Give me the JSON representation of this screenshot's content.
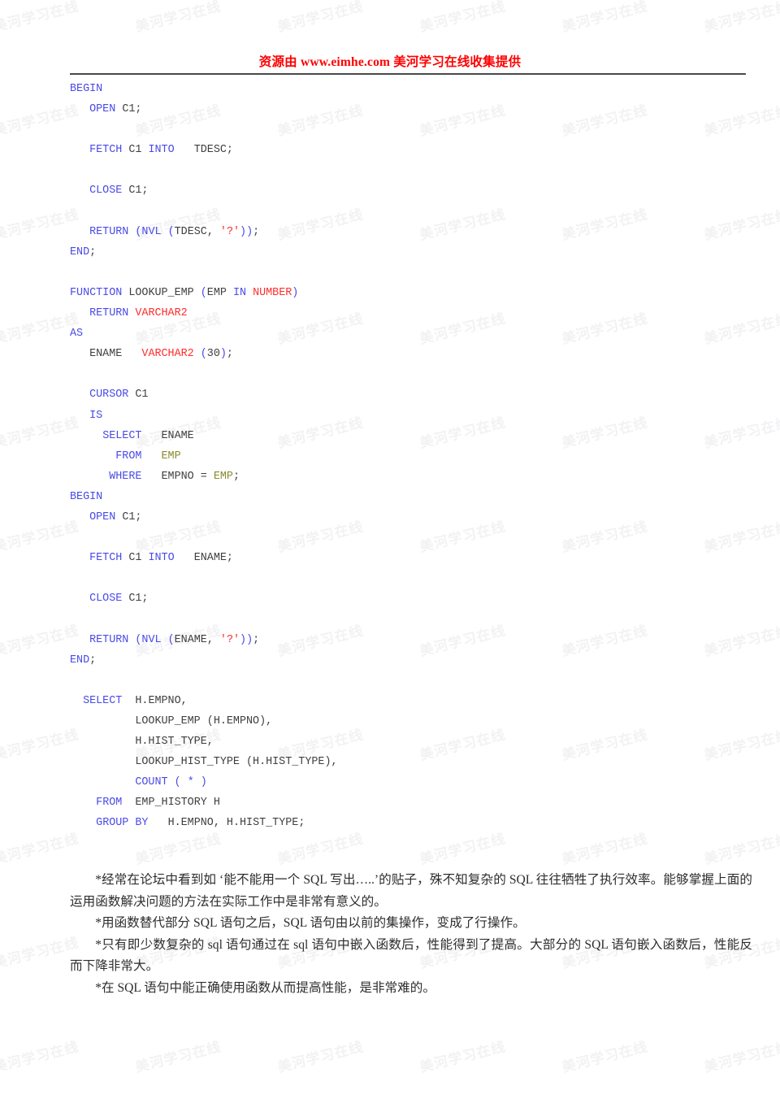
{
  "document": {
    "header": {
      "watermark_notice": "资源由 www.eimhe.com 美河学习在线收集提供",
      "rule_color": "#4a4a4a"
    },
    "background_watermark_text": "美河学习在线",
    "colors": {
      "keyword": "#4a4ae8",
      "datatype": "#ff2d2d",
      "variable": "#8a8a2e",
      "identifier": "#3f3f3f",
      "header_red": "#ff0000",
      "page_background": "#ffffff"
    },
    "code": {
      "language": "PL/SQL",
      "lines": [
        "BEGIN",
        "   OPEN C1;",
        "",
        "   FETCH C1 INTO   TDESC;",
        "",
        "   CLOSE C1;",
        "",
        "   RETURN (NVL (TDESC, '?'));",
        "END;",
        "",
        "FUNCTION LOOKUP_EMP (EMP IN NUMBER)",
        "   RETURN VARCHAR2",
        "AS",
        "   ENAME   VARCHAR2 (30);",
        "",
        "   CURSOR C1",
        "   IS",
        "     SELECT   ENAME",
        "       FROM   EMP",
        "      WHERE   EMPNO = EMP;",
        "BEGIN",
        "   OPEN C1;",
        "",
        "   FETCH C1 INTO   ENAME;",
        "",
        "   CLOSE C1;",
        "",
        "   RETURN (NVL (ENAME, '?'));",
        "END;",
        "",
        "  SELECT  H.EMPNO,",
        "          LOOKUP_EMP (H.EMPNO),",
        "          H.HIST_TYPE,",
        "          LOOKUP_HIST_TYPE (H.HIST_TYPE),",
        "          COUNT ( * )",
        "    FROM  EMP_HISTORY H",
        "    GROUP BY   H.EMPNO, H.HIST_TYPE;"
      ]
    },
    "prose": {
      "paragraphs": [
        "*经常在论坛中看到如 ‘能不能用一个 SQL 写出…..’的贴子，殊不知复杂的 SQL 往往牺牲了执行效率。能够掌握上面的运用函数解决问题的方法在实际工作中是非常有意义的。",
        "*用函数替代部分 SQL 语句之后，SQL 语句由以前的集操作，变成了行操作。",
        "*只有即少数复杂的 sql 语句通过在 sql 语句中嵌入函数后，性能得到了提高。大部分的 SQL 语句嵌入函数后，性能反而下降非常大。",
        "*在 SQL 语句中能正确使用函数从而提高性能，是非常难的。"
      ]
    }
  }
}
